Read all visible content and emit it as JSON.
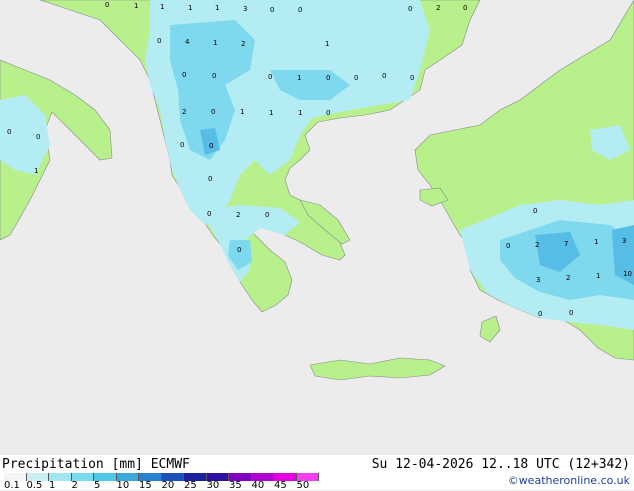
{
  "footer": {
    "title": "Precipitation [mm]",
    "model": "ECMWF",
    "valid_time": "Su 12-04-2026 12..18 UTC (12+342)",
    "credit": "©weatheronline.co.uk"
  },
  "legend": {
    "ticks": [
      "0.1",
      "0.5",
      "1",
      "2",
      "5",
      "10",
      "15",
      "20",
      "25",
      "30",
      "35",
      "40",
      "45",
      "50"
    ],
    "colors": [
      "#f5f5f5",
      "#c8f0f0",
      "#a0e8f0",
      "#78dcef",
      "#50c8e8",
      "#3aa8dc",
      "#2a80d0",
      "#1a50b8",
      "#1a20a0",
      "#3010a0",
      "#8000c0",
      "#b000d0",
      "#e000e0",
      "#f040f0"
    ]
  },
  "map": {
    "colors": {
      "sea": "#ececec",
      "land": "#b8f08c",
      "light_rain": "#b4ecf4",
      "moderate_rain": "#7ed8ee",
      "heavy_rain": "#56bde6",
      "border": "#8a8a8a"
    },
    "values": [
      "0",
      "1",
      "1",
      "1",
      "1",
      "3",
      "0",
      "0",
      "0",
      "2",
      "0",
      "0",
      "4",
      "1",
      "2",
      "1",
      "0",
      "0",
      "0",
      "0",
      "1",
      "0",
      "0",
      "0",
      "0",
      "0",
      "2",
      "0",
      "1",
      "1",
      "1",
      "0",
      "1",
      "0",
      "0",
      "0",
      "2",
      "0",
      "0",
      "0",
      "0",
      "2",
      "7",
      "1",
      "3",
      "3",
      "2",
      "1",
      "10",
      "0",
      "0",
      "0"
    ]
  }
}
